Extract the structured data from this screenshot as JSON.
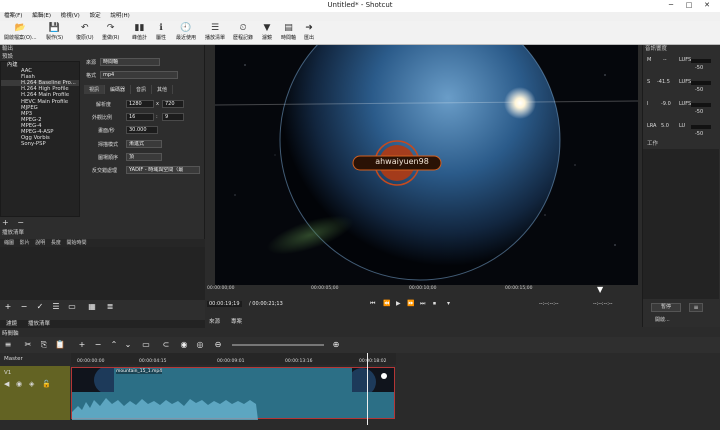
{
  "window": {
    "title": "Untitled* - Shotcut",
    "minimize": "─",
    "maximize": "□",
    "close": "✕"
  },
  "menu": [
    "檔案(F)",
    "編輯(E)",
    "檢視(V)",
    "設定",
    "說明(H)"
  ],
  "toolbar": [
    {
      "label": "開啟檔案(O)...",
      "icon": "open-folder-icon",
      "glyph": "📂"
    },
    {
      "label": "製作(S)",
      "icon": "save-icon",
      "glyph": "💾"
    },
    {
      "label": "復原(U)",
      "icon": "undo-icon",
      "glyph": "↶"
    },
    {
      "label": "重做(R)",
      "icon": "redo-icon",
      "glyph": "↷"
    },
    {
      "label": "峰值計",
      "icon": "peak-meter-icon",
      "glyph": "▮▮"
    },
    {
      "label": "屬性",
      "icon": "properties-icon",
      "glyph": "ℹ"
    },
    {
      "label": "最近使用",
      "icon": "recent-icon",
      "glyph": "🕘"
    },
    {
      "label": "播放清單",
      "icon": "playlist-icon",
      "glyph": "☰"
    },
    {
      "label": "歷程記錄",
      "icon": "history-icon",
      "glyph": "⏲"
    },
    {
      "label": "濾鏡",
      "icon": "filter-icon",
      "glyph": "▼"
    },
    {
      "label": "時間軸",
      "icon": "timeline-icon",
      "glyph": "▤"
    },
    {
      "label": "匯出",
      "icon": "export-icon",
      "glyph": "➜"
    }
  ],
  "export": {
    "dock_title": "輸出",
    "presets_label": "預設",
    "from_label": "來源",
    "from_value": "時間軸",
    "format_label": "格式",
    "format_value": "mp4",
    "tabs": [
      "視訊",
      "編碼器",
      "音訊",
      "其他"
    ],
    "resolution_label": "解析度",
    "res_w": "1280",
    "res_x": "x",
    "res_h": "720",
    "aspect_label": "外觀比例",
    "aspect_w": "16",
    "aspect_colon": ":",
    "aspect_h": "9",
    "fps_label": "畫面/秒",
    "fps_value": "30.000",
    "scan_label": "掃描模式",
    "scan_value": "漸進式",
    "field_label": "圖場順序",
    "field_value": "頂",
    "deint_label": "反交錯處理",
    "deint_value": "YADIF - 時域與空間（最"
  },
  "presets": [
    {
      "label": "內建",
      "group": true
    },
    {
      "label": "AAC"
    },
    {
      "label": "Flash"
    },
    {
      "label": "H.264 Baseline Pro..."
    },
    {
      "label": "H.264 High Profile"
    },
    {
      "label": "H.264 Main Profile"
    },
    {
      "label": "HEVC Main Profile"
    },
    {
      "label": "MJPEG"
    },
    {
      "label": "MP3"
    },
    {
      "label": "MPEG-2"
    },
    {
      "label": "MPEG-4"
    },
    {
      "label": "MPEG-4-ASP"
    },
    {
      "label": "Ogg Vorbis"
    },
    {
      "label": "Sony-PSP"
    }
  ],
  "playlist": {
    "title": "播放清單",
    "columns": [
      "縮圖",
      "影片",
      "說明",
      "長度",
      "開始時間"
    ],
    "tab_properties": "濾鏡",
    "tab_playlist": "播放清單"
  },
  "viewer": {
    "watermark": "ahwaiyuen98",
    "ruler": [
      "00:00:00;00",
      "00:00:05;00",
      "00:00:10;00",
      "00:00:15;00"
    ],
    "position": "00:00:19;19",
    "duration": "/ 00:00:21;13",
    "in_point": "--:--:--:--",
    "out_point": "--:--:--:--",
    "tab_source": "來源",
    "tab_project": "專案"
  },
  "meters": {
    "title": "音訊響度",
    "rows": [
      {
        "key": "M",
        "value": "--",
        "unit": "LUFS",
        "scale": "-50"
      },
      {
        "key": "S",
        "value": "-41.5",
        "unit": "LUFS",
        "scale": "-50"
      },
      {
        "key": "I",
        "value": "-9.0",
        "unit": "LUFS",
        "scale": "-50"
      },
      {
        "key": "LRA",
        "value": "5.0",
        "unit": "LU",
        "scale": "-50"
      }
    ],
    "jobs_title": "工作",
    "pause_label": "暫停",
    "open_label": "開啟...",
    "menu_icon": "≡"
  },
  "timeline": {
    "title": "時間軸",
    "master_label": "Master",
    "track_label": "V1",
    "ruler": [
      "00:00:00:00",
      "00:00:04:15",
      "00:00:09:01",
      "00:00:13:16",
      "00:00:18:02"
    ],
    "clip_name": "mountain_15_1.mp4"
  }
}
